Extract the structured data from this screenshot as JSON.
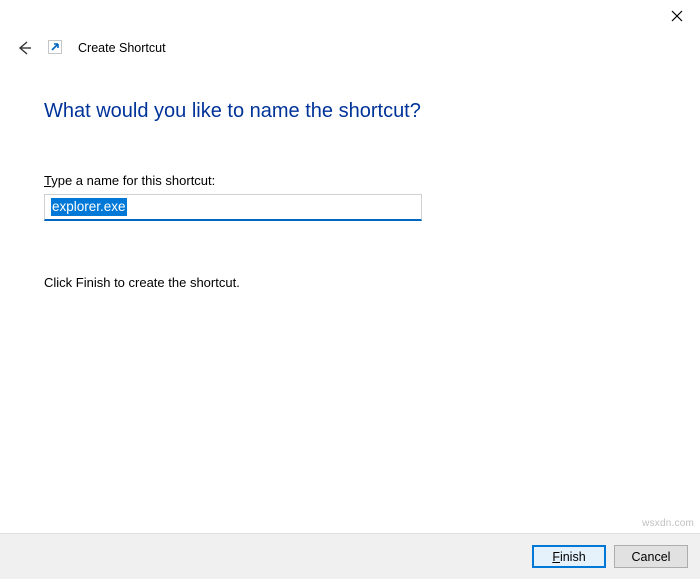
{
  "titlebar": {
    "close_label": "Close"
  },
  "header": {
    "title": "Create Shortcut"
  },
  "content": {
    "heading": "What would you like to name the shortcut?",
    "label_prefix": "T",
    "label_rest": "ype a name for this shortcut:",
    "input_value": "explorer.exe",
    "instruction": "Click Finish to create the shortcut."
  },
  "footer": {
    "finish_prefix": "F",
    "finish_rest": "inish",
    "cancel_label": "Cancel"
  },
  "watermark": "wsxdn.com"
}
